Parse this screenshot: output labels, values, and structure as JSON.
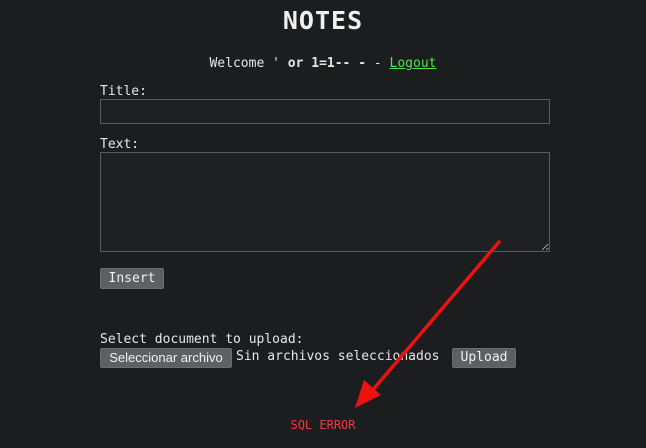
{
  "header": {
    "title": "NOTES"
  },
  "welcome": {
    "prefix": "Welcome ' ",
    "user": "or 1=1-- -",
    "separator": " - ",
    "logout_label": "Logout",
    "logout_color": "#4ee44e"
  },
  "form": {
    "title_label": "Title:",
    "title_value": "",
    "text_label": "Text:",
    "text_value": "",
    "insert_label": "Insert"
  },
  "upload": {
    "label": "Select document to upload:",
    "choose_file_label": "Seleccionar archivo",
    "no_file_text": "Sin archivos seleccionados",
    "upload_label": "Upload"
  },
  "status": {
    "error_text": "SQL ERROR",
    "error_color": "#f03a3a"
  },
  "annotation": {
    "arrow_color": "#ee1111"
  }
}
